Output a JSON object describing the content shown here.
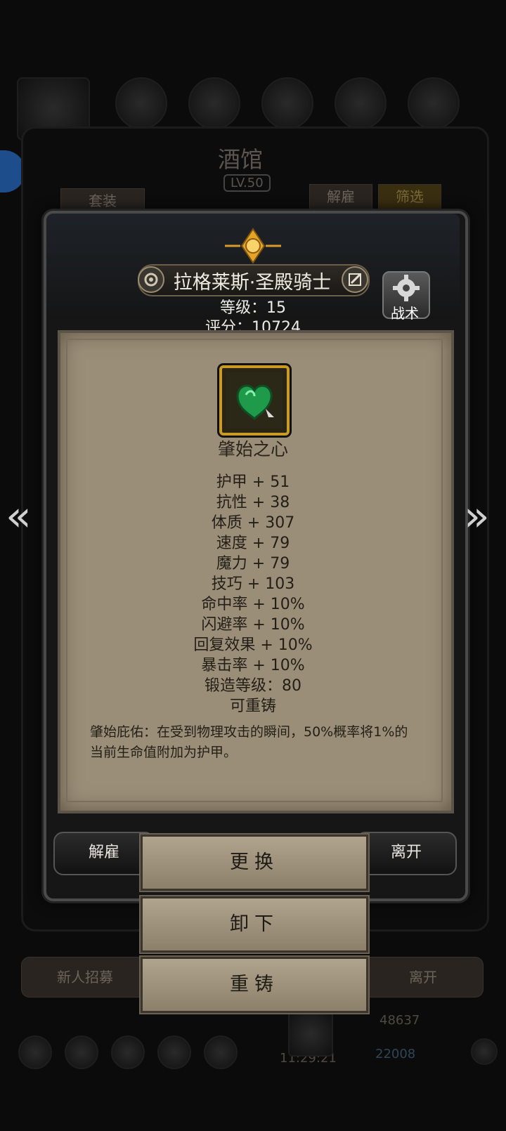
{
  "background": {
    "tavern_title": "酒馆",
    "tavern_level": "LV.50",
    "set_button": "套装",
    "dismiss_button": "解雇",
    "filter_button": "筛选",
    "recruit_button": "新人招募",
    "leave_button": "离开",
    "gold": "48637",
    "gems": "22008",
    "clock": "11:29:21"
  },
  "hero": {
    "name": "拉格莱斯·圣殿骑士",
    "level_text": "等级：15",
    "score_text": "评分：10724",
    "tactics_label": "战术"
  },
  "item": {
    "name": "肇始之心",
    "icon": "green-gem-heart-icon",
    "stats": [
      "护甲 + 51",
      "抗性 + 38",
      "体质 + 307",
      "速度 + 79",
      "魔力 + 79",
      "技巧 + 103",
      "命中率 + 10%",
      "闪避率 + 10%",
      "回复效果 + 10%",
      "暴击率 + 10%",
      "锻造等级：80",
      "可重铸"
    ],
    "description": "肇始庇佑：在受到物理攻击的瞬间，50%概率将1%的当前生命值附加为护甲。"
  },
  "actions": {
    "dismiss": "解雇",
    "leave": "离开",
    "replace": "更换",
    "unequip": "卸下",
    "reforge": "重铸"
  },
  "colors": {
    "parchment": "#9a8e79",
    "gold_frame": "#c99a24",
    "button_tan": "#a89c86"
  }
}
